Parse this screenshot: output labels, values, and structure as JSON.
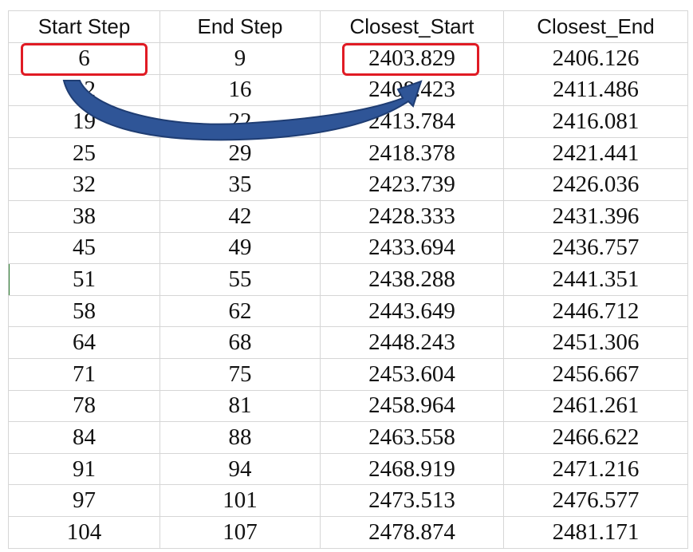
{
  "table": {
    "headers": [
      "Start Step",
      "End Step",
      "Closest_Start",
      "Closest_End"
    ],
    "rows": [
      [
        "6",
        "9",
        "2403.829",
        "2406.126"
      ],
      [
        "12",
        "16",
        "2408.423",
        "2411.486"
      ],
      [
        "19",
        "22",
        "2413.784",
        "2416.081"
      ],
      [
        "25",
        "29",
        "2418.378",
        "2421.441"
      ],
      [
        "32",
        "35",
        "2423.739",
        "2426.036"
      ],
      [
        "38",
        "42",
        "2428.333",
        "2431.396"
      ],
      [
        "45",
        "49",
        "2433.694",
        "2436.757"
      ],
      [
        "51",
        "55",
        "2438.288",
        "2441.351"
      ],
      [
        "58",
        "62",
        "2443.649",
        "2446.712"
      ],
      [
        "64",
        "68",
        "2448.243",
        "2451.306"
      ],
      [
        "71",
        "75",
        "2453.604",
        "2456.667"
      ],
      [
        "78",
        "81",
        "2458.964",
        "2461.261"
      ],
      [
        "84",
        "88",
        "2463.558",
        "2466.622"
      ],
      [
        "91",
        "94",
        "2468.919",
        "2471.216"
      ],
      [
        "97",
        "101",
        "2473.513",
        "2476.577"
      ],
      [
        "104",
        "107",
        "2478.874",
        "2481.171"
      ]
    ]
  },
  "colors": {
    "highlight": "#e01b24",
    "arrow": "#2f5597",
    "grid": "#d6d6d6"
  }
}
